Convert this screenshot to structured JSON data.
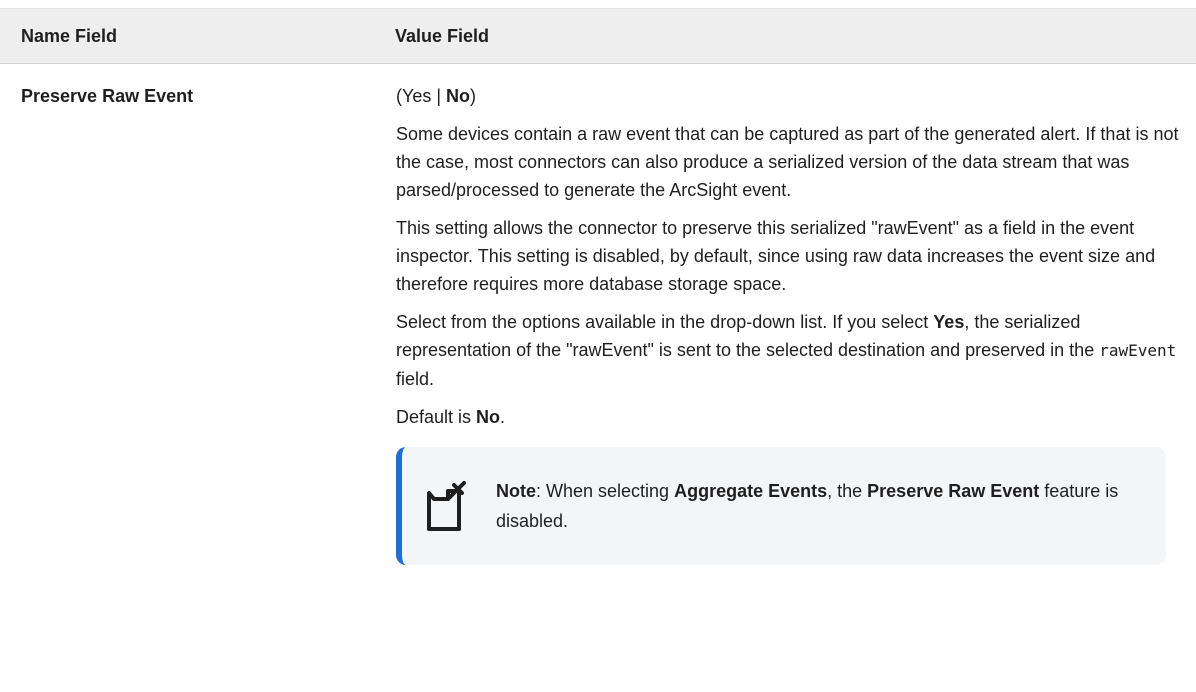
{
  "table": {
    "headers": {
      "name": "Name Field",
      "value": "Value Field"
    },
    "row": {
      "name": "Preserve Raw Event",
      "options": {
        "open": "(Yes | ",
        "bold": "No",
        "close": ")"
      },
      "para1": "Some devices contain a raw event that can be captured as part of the generated alert. If that is not the case, most connectors can also produce a serialized version of the data stream that was parsed/processed to generate the ArcSight event.",
      "para2": "This setting allows the connector to preserve this serialized \"rawEvent\" as a field in the event inspector. This setting is disabled, by default, since using raw data increases the event size and therefore requires more database storage space.",
      "para3": {
        "pre": "Select from the options available in the drop-down list. If you select ",
        "bold": "Yes",
        "mid": ", the serialized representation of the \"rawEvent\" is sent to the selected destination and preserved in the ",
        "code": "rawEvent",
        "post": " field."
      },
      "default": {
        "pre": "Default is ",
        "bold": "No",
        "post": "."
      },
      "note": {
        "label": "Note",
        "t1": ": When selecting ",
        "b1": "Aggregate Events",
        "t2": ", the ",
        "b2": "Preserve Raw Event",
        "t3": " feature is disabled."
      }
    }
  },
  "colors": {
    "header_bg": "#eeeeee",
    "note_bg": "#f4f5f7",
    "note_accent": "#1f6fd6"
  }
}
